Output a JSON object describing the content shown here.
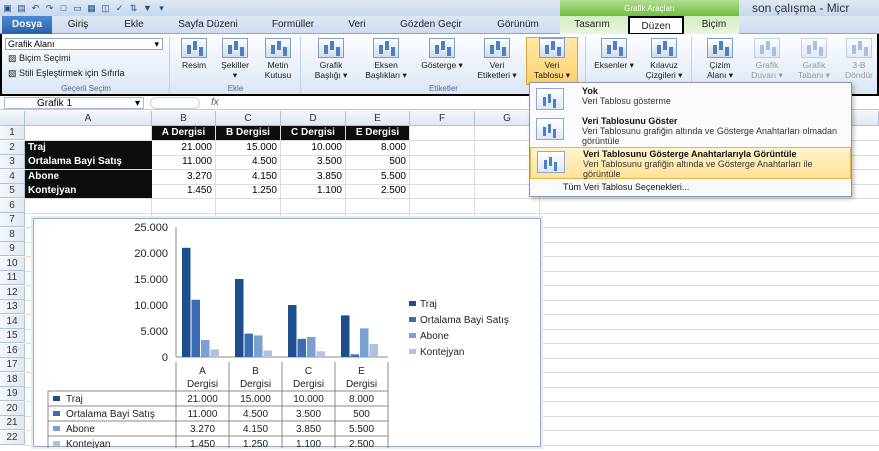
{
  "window": {
    "context_title": "Grafik Araçları",
    "doc_title": "son çalışma - Micr"
  },
  "tabs": [
    "Dosya",
    "Giriş",
    "Ekle",
    "Sayfa Düzeni",
    "Formüller",
    "Veri",
    "Gözden Geçir",
    "Görünüm",
    "Tasarım",
    "Düzen",
    "Biçim"
  ],
  "ribbon": {
    "selection_combo": "Grafik Alanı",
    "format_selection": "Biçim Seçimi",
    "reset_style": "Stili Eşleştirmek için Sıfırla",
    "group_current": "Geçerli Seçim",
    "picture": "Resim",
    "shapes": "Şekiller",
    "textbox_1": "Metin",
    "textbox_2": "Kutusu",
    "group_insert": "Ekle",
    "chart_title_1": "Grafik",
    "chart_title_2": "Başlığı ▾",
    "axis_titles_1": "Eksen",
    "axis_titles_2": "Başlıkları ▾",
    "legend": "Gösterge ▾",
    "data_labels_1": "Veri",
    "data_labels_2": "Etiketleri ▾",
    "data_table_1": "Veri",
    "data_table_2": "Tablosu ▾",
    "group_labels": "Etiketler",
    "axes": "Eksenler ▾",
    "gridlines_1": "Kılavuz",
    "gridlines_2": "Çizgileri ▾",
    "plot_area_1": "Çizim",
    "plot_area_2": "Alanı ▾",
    "chart_wall_1": "Grafik",
    "chart_wall_2": "Duvarı ▾",
    "chart_floor_1": "Grafik",
    "chart_floor_2": "Tabanı ▾",
    "rotation_1": "3-B",
    "rotation_2": "Döndür"
  },
  "formula_bar": {
    "name_box": "Grafik 1",
    "fx": "fx"
  },
  "sheet": {
    "columns": [
      "A",
      "B",
      "C",
      "D",
      "E",
      "F",
      "G"
    ],
    "rows": [
      "1",
      "2",
      "3",
      "4",
      "5",
      "6",
      "7",
      "8",
      "9",
      "10",
      "11",
      "12",
      "13",
      "14",
      "15",
      "16",
      "17",
      "18",
      "19",
      "20",
      "21",
      "22"
    ],
    "headers": [
      "A Dergisi",
      "B Dergisi",
      "C Dergisi",
      "E Dergisi"
    ],
    "table": [
      {
        "label": "Traj",
        "values": [
          "21.000",
          "15.000",
          "10.000",
          "8.000"
        ]
      },
      {
        "label": "Ortalama Bayi Satış",
        "values": [
          "11.000",
          "4.500",
          "3.500",
          "500"
        ]
      },
      {
        "label": "Abone",
        "values": [
          "3.270",
          "4.150",
          "3.850",
          "5.500"
        ]
      },
      {
        "label": "Kontejyan",
        "values": [
          "1.450",
          "1.250",
          "1.100",
          "2.500"
        ]
      }
    ]
  },
  "dropdown": {
    "items": [
      {
        "title": "Yok",
        "desc": "Veri Tablosu gösterme"
      },
      {
        "title": "Veri Tablosunu Göster",
        "desc": "Veri Tablosunu grafiğin altında ve Gösterge Anahtarları olmadan görüntüle"
      },
      {
        "title": "Veri Tablosunu Gösterge Anahtarlarıyla Görüntüle",
        "desc": "Veri Tablosunu grafiğin altında ve Gösterge Anahtarları ile görüntüle"
      }
    ],
    "more": "Tüm Veri Tablosu Seçenekleri..."
  },
  "chart_data": {
    "type": "bar",
    "categories": [
      "A Dergisi",
      "B Dergisi",
      "C Dergisi",
      "E Dergisi"
    ],
    "category_lines": [
      [
        "A",
        "Dergisi"
      ],
      [
        "B",
        "Dergisi"
      ],
      [
        "C",
        "Dergisi"
      ],
      [
        "E",
        "Dergisi"
      ]
    ],
    "series": [
      {
        "name": "Traj",
        "values": [
          21000,
          15000,
          10000,
          8000
        ],
        "color": "#1f4e8c"
      },
      {
        "name": "Ortalama Bayi Satış",
        "values": [
          11000,
          4500,
          3500,
          500
        ],
        "color": "#3a6db5"
      },
      {
        "name": "Abone",
        "values": [
          3270,
          4150,
          3850,
          5500
        ],
        "color": "#7b9fd1"
      },
      {
        "name": "Kontejyan",
        "values": [
          1450,
          1250,
          1100,
          2500
        ],
        "color": "#aec3e2"
      }
    ],
    "yticks": [
      "25.000",
      "20.000",
      "15.000",
      "10.000",
      "5.000",
      "0"
    ],
    "ylim": [
      0,
      25000
    ],
    "data_table": [
      [
        "21.000",
        "15.000",
        "10.000",
        "8.000"
      ],
      [
        "11.000",
        "4.500",
        "3.500",
        "500"
      ],
      [
        "3.270",
        "4.150",
        "3.850",
        "5.500"
      ],
      [
        "1.450",
        "1.250",
        "1.100",
        "2.500"
      ]
    ],
    "legend_position": "right",
    "grid": false
  }
}
